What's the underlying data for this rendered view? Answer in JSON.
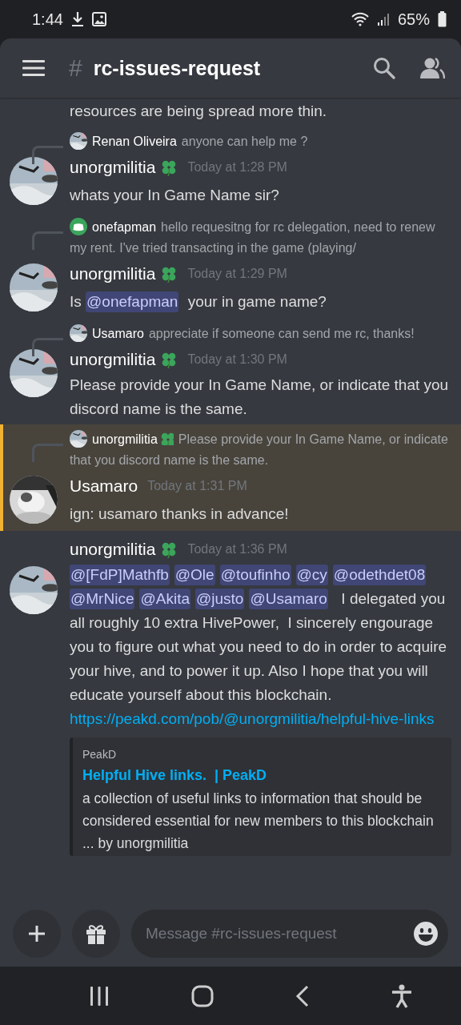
{
  "status_bar": {
    "time": "1:44",
    "battery": "65%"
  },
  "header": {
    "hash": "#",
    "channel": "rc-issues-request"
  },
  "messages": [
    {
      "kind": "continuation",
      "highlighted": false,
      "content": [
        {
          "kind": "text",
          "text": "resources are being spread more thin."
        }
      ]
    },
    {
      "kind": "message",
      "reply": {
        "author": "Renan Oliveira",
        "badge": false,
        "text": "anyone can help me ?"
      },
      "author": "unorgmilitia",
      "badge": true,
      "time": "Today at 1:28 PM",
      "highlighted": false,
      "content": [
        {
          "kind": "text",
          "text": "whats your In Game Name sir?"
        }
      ]
    },
    {
      "kind": "message",
      "reply": {
        "author": "onefapman",
        "kind": "default",
        "badge": false,
        "text": "hello requesitng for rc delegation, need to renew my rent. I've tried transacting in the game (playing/"
      },
      "author": "unorgmilitia",
      "badge": true,
      "time": "Today at 1:29 PM",
      "highlighted": false,
      "content": [
        {
          "kind": "text",
          "text": "Is "
        },
        {
          "kind": "mention",
          "text": "@onefapman"
        },
        {
          "kind": "text",
          "text": " your in game name?"
        }
      ]
    },
    {
      "kind": "message",
      "reply": {
        "author": "Usamaro",
        "badge": false,
        "text": "appreciate if someone can send me rc, thanks!"
      },
      "author": "unorgmilitia",
      "badge": true,
      "time": "Today at 1:30 PM",
      "highlighted": false,
      "content": [
        {
          "kind": "text",
          "text": "Please provide your In Game Name, or indicate that you discord name is the same."
        }
      ]
    },
    {
      "kind": "message",
      "reply": {
        "author": "unorgmilitia",
        "badge": true,
        "text": "Please provide your In Game Name, or indicate that you discord name is the same."
      },
      "author": "Usamaro",
      "badge": false,
      "time": "Today at 1:31 PM",
      "highlighted": true,
      "content": [
        {
          "kind": "text",
          "text": "ign: usamaro thanks in advance!"
        }
      ]
    },
    {
      "kind": "message",
      "author": "unorgmilitia",
      "badge": true,
      "time": "Today at 1:36 PM",
      "highlighted": false,
      "content": [
        {
          "kind": "mention",
          "text": "@[FdP]Mathfb"
        },
        {
          "kind": "mention",
          "text": "@Ole"
        },
        {
          "kind": "mention",
          "text": "@toufinho"
        },
        {
          "kind": "mention",
          "text": "@cy"
        },
        {
          "kind": "mention",
          "text": "@odethdet08"
        },
        {
          "kind": "mention",
          "text": "@MrNice"
        },
        {
          "kind": "mention",
          "text": "@Akita"
        },
        {
          "kind": "mention",
          "text": "@justo"
        },
        {
          "kind": "mention",
          "text": "@Usamaro"
        },
        {
          "kind": "text",
          "text": "  I delegated you all roughly 10 extra HivePower,  I sincerely engourage you to figure out what you need to do in order to acquire your hive, and to power it up. Also I hope that you will educate yourself about this blockchain."
        },
        {
          "kind": "link",
          "text": "https://peakd.com/pob/@unorgmilitia/helpful-hive-links"
        }
      ],
      "embed": {
        "provider": "PeakD",
        "title": "Helpful Hive links.  | PeakD",
        "description": "a collection of useful links to information that should be considered essential for new members to this blockchain  ... by unorgmilitia"
      }
    }
  ],
  "composer": {
    "placeholder": "Message #rc-issues-request"
  }
}
